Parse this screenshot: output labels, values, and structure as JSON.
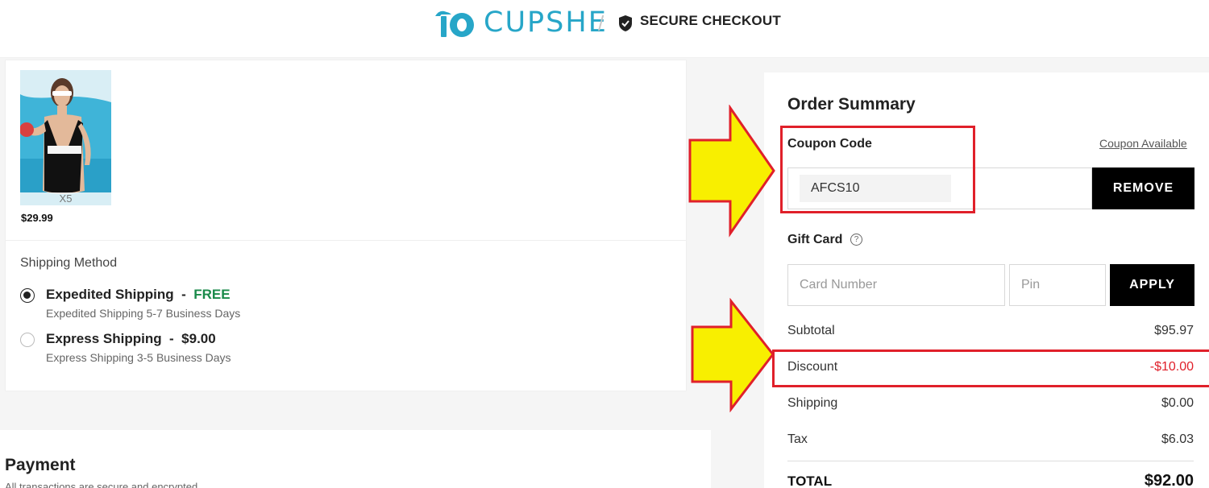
{
  "header": {
    "brand": "CUPSHE",
    "separator": "/",
    "secure_label": "SECURE CHECKOUT",
    "logo_icon": "palm-10-logo",
    "secure_icon": "shield-check-icon",
    "brand_color": "#27a6c8"
  },
  "product": {
    "quantity": "X5",
    "price": "$29.99"
  },
  "shipping": {
    "title": "Shipping Method",
    "options": [
      {
        "name": "Expedited Shipping",
        "sep": "-",
        "price": "FREE",
        "detail": "Expedited Shipping 5-7 Business Days",
        "selected": true
      },
      {
        "name": "Express Shipping",
        "sep": "-",
        "price": "$9.00",
        "detail": "Express Shipping 3-5 Business Days",
        "selected": false
      }
    ]
  },
  "payment": {
    "title": "Payment",
    "subtitle": "All transactions are secure and encrypted."
  },
  "summary": {
    "title": "Order Summary",
    "coupon": {
      "label": "Coupon Code",
      "available_link": "Coupon Available",
      "value": "AFCS10",
      "button": "REMOVE"
    },
    "gift_card": {
      "label": "Gift Card",
      "help_icon": "question-circle-icon",
      "card_placeholder": "Card Number",
      "pin_placeholder": "Pin",
      "button": "APPLY"
    },
    "rows": [
      {
        "label": "Subtotal",
        "value": "$95.97"
      },
      {
        "label": "Discount",
        "value": "-$10.00"
      },
      {
        "label": "Shipping",
        "value": "$0.00"
      },
      {
        "label": "Tax",
        "value": "$6.03"
      }
    ],
    "total_label": "TOTAL",
    "total_value": "$92.00",
    "discount_color": "#e0202a"
  }
}
